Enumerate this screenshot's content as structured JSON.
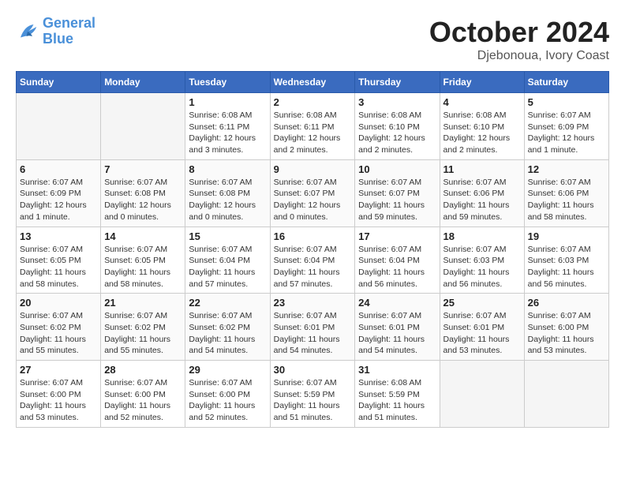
{
  "header": {
    "logo_line1": "General",
    "logo_line2": "Blue",
    "month": "October 2024",
    "location": "Djebonoua, Ivory Coast"
  },
  "weekdays": [
    "Sunday",
    "Monday",
    "Tuesday",
    "Wednesday",
    "Thursday",
    "Friday",
    "Saturday"
  ],
  "weeks": [
    [
      {
        "day": "",
        "info": ""
      },
      {
        "day": "",
        "info": ""
      },
      {
        "day": "1",
        "info": "Sunrise: 6:08 AM\nSunset: 6:11 PM\nDaylight: 12 hours and 3 minutes."
      },
      {
        "day": "2",
        "info": "Sunrise: 6:08 AM\nSunset: 6:11 PM\nDaylight: 12 hours and 2 minutes."
      },
      {
        "day": "3",
        "info": "Sunrise: 6:08 AM\nSunset: 6:10 PM\nDaylight: 12 hours and 2 minutes."
      },
      {
        "day": "4",
        "info": "Sunrise: 6:08 AM\nSunset: 6:10 PM\nDaylight: 12 hours and 2 minutes."
      },
      {
        "day": "5",
        "info": "Sunrise: 6:07 AM\nSunset: 6:09 PM\nDaylight: 12 hours and 1 minute."
      }
    ],
    [
      {
        "day": "6",
        "info": "Sunrise: 6:07 AM\nSunset: 6:09 PM\nDaylight: 12 hours and 1 minute."
      },
      {
        "day": "7",
        "info": "Sunrise: 6:07 AM\nSunset: 6:08 PM\nDaylight: 12 hours and 0 minutes."
      },
      {
        "day": "8",
        "info": "Sunrise: 6:07 AM\nSunset: 6:08 PM\nDaylight: 12 hours and 0 minutes."
      },
      {
        "day": "9",
        "info": "Sunrise: 6:07 AM\nSunset: 6:07 PM\nDaylight: 12 hours and 0 minutes."
      },
      {
        "day": "10",
        "info": "Sunrise: 6:07 AM\nSunset: 6:07 PM\nDaylight: 11 hours and 59 minutes."
      },
      {
        "day": "11",
        "info": "Sunrise: 6:07 AM\nSunset: 6:06 PM\nDaylight: 11 hours and 59 minutes."
      },
      {
        "day": "12",
        "info": "Sunrise: 6:07 AM\nSunset: 6:06 PM\nDaylight: 11 hours and 58 minutes."
      }
    ],
    [
      {
        "day": "13",
        "info": "Sunrise: 6:07 AM\nSunset: 6:05 PM\nDaylight: 11 hours and 58 minutes."
      },
      {
        "day": "14",
        "info": "Sunrise: 6:07 AM\nSunset: 6:05 PM\nDaylight: 11 hours and 58 minutes."
      },
      {
        "day": "15",
        "info": "Sunrise: 6:07 AM\nSunset: 6:04 PM\nDaylight: 11 hours and 57 minutes."
      },
      {
        "day": "16",
        "info": "Sunrise: 6:07 AM\nSunset: 6:04 PM\nDaylight: 11 hours and 57 minutes."
      },
      {
        "day": "17",
        "info": "Sunrise: 6:07 AM\nSunset: 6:04 PM\nDaylight: 11 hours and 56 minutes."
      },
      {
        "day": "18",
        "info": "Sunrise: 6:07 AM\nSunset: 6:03 PM\nDaylight: 11 hours and 56 minutes."
      },
      {
        "day": "19",
        "info": "Sunrise: 6:07 AM\nSunset: 6:03 PM\nDaylight: 11 hours and 56 minutes."
      }
    ],
    [
      {
        "day": "20",
        "info": "Sunrise: 6:07 AM\nSunset: 6:02 PM\nDaylight: 11 hours and 55 minutes."
      },
      {
        "day": "21",
        "info": "Sunrise: 6:07 AM\nSunset: 6:02 PM\nDaylight: 11 hours and 55 minutes."
      },
      {
        "day": "22",
        "info": "Sunrise: 6:07 AM\nSunset: 6:02 PM\nDaylight: 11 hours and 54 minutes."
      },
      {
        "day": "23",
        "info": "Sunrise: 6:07 AM\nSunset: 6:01 PM\nDaylight: 11 hours and 54 minutes."
      },
      {
        "day": "24",
        "info": "Sunrise: 6:07 AM\nSunset: 6:01 PM\nDaylight: 11 hours and 54 minutes."
      },
      {
        "day": "25",
        "info": "Sunrise: 6:07 AM\nSunset: 6:01 PM\nDaylight: 11 hours and 53 minutes."
      },
      {
        "day": "26",
        "info": "Sunrise: 6:07 AM\nSunset: 6:00 PM\nDaylight: 11 hours and 53 minutes."
      }
    ],
    [
      {
        "day": "27",
        "info": "Sunrise: 6:07 AM\nSunset: 6:00 PM\nDaylight: 11 hours and 53 minutes."
      },
      {
        "day": "28",
        "info": "Sunrise: 6:07 AM\nSunset: 6:00 PM\nDaylight: 11 hours and 52 minutes."
      },
      {
        "day": "29",
        "info": "Sunrise: 6:07 AM\nSunset: 6:00 PM\nDaylight: 11 hours and 52 minutes."
      },
      {
        "day": "30",
        "info": "Sunrise: 6:07 AM\nSunset: 5:59 PM\nDaylight: 11 hours and 51 minutes."
      },
      {
        "day": "31",
        "info": "Sunrise: 6:08 AM\nSunset: 5:59 PM\nDaylight: 11 hours and 51 minutes."
      },
      {
        "day": "",
        "info": ""
      },
      {
        "day": "",
        "info": ""
      }
    ]
  ]
}
